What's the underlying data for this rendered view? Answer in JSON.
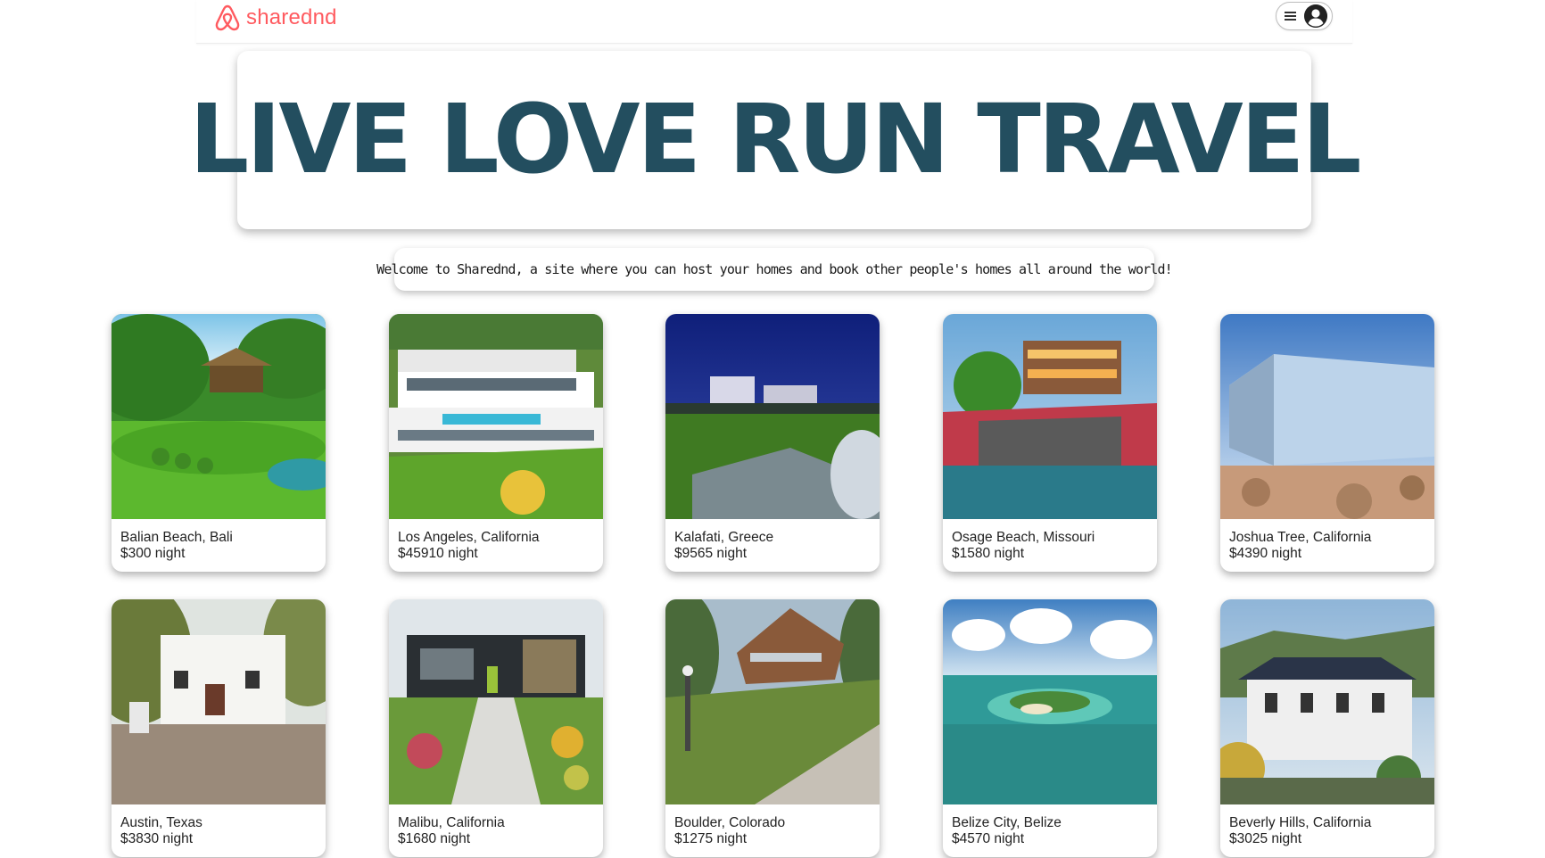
{
  "brand": {
    "name": "sharednd",
    "color": "#ff5a5f"
  },
  "nav": {
    "menu_icon": "hamburger-icon",
    "account_icon": "user-avatar-icon"
  },
  "hero": {
    "title": "LIVE LOVE RUN TRAVEL",
    "color": "#234e5f"
  },
  "welcome": {
    "text": "Welcome to Sharednd, a site where you can host your homes and book other people's homes all around the world!"
  },
  "listings": [
    {
      "location": "Balian Beach, Bali",
      "price": "$300 night"
    },
    {
      "location": "Los Angeles, California",
      "price": "$45910 night"
    },
    {
      "location": "Kalafati, Greece",
      "price": "$9565 night"
    },
    {
      "location": "Osage Beach, Missouri",
      "price": "$1580 night"
    },
    {
      "location": "Joshua Tree, California",
      "price": "$4390 night"
    },
    {
      "location": "Austin, Texas",
      "price": "$3830 night"
    },
    {
      "location": "Malibu, California",
      "price": "$1680 night"
    },
    {
      "location": "Boulder, Colorado",
      "price": "$1275 night"
    },
    {
      "location": "Belize City, Belize",
      "price": "$4570 night"
    },
    {
      "location": "Beverly Hills, California",
      "price": "$3025 night"
    }
  ]
}
